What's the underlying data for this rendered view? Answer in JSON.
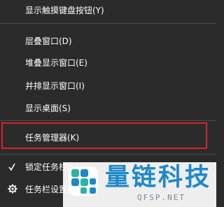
{
  "menu": {
    "items": [
      {
        "label": "显示触摸键盘按钮(Y)"
      },
      {
        "label": "层叠窗口(D)"
      },
      {
        "label": "堆叠显示窗口(E)"
      },
      {
        "label": "并排显示窗口(I)"
      },
      {
        "label": "显示桌面(S)"
      },
      {
        "label": "任务管理器(K)"
      },
      {
        "label": "锁定任务栏(L)",
        "checked": true
      },
      {
        "label": "任务栏设置(T)",
        "icon": "gear-icon"
      }
    ],
    "highlight_color": "#d6242a"
  },
  "watermark": {
    "title": "量链科技",
    "url": "QFSP.NET",
    "color": "#1e88c8"
  }
}
